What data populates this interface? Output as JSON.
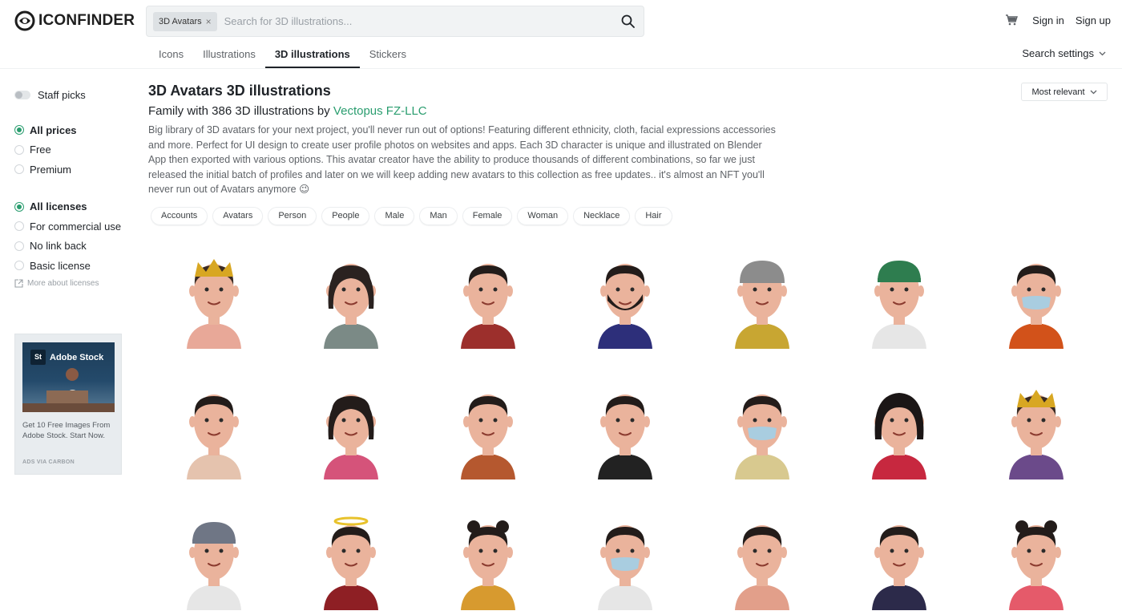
{
  "header": {
    "logo_text": "ICONFINDER",
    "search_chip": "3D Avatars",
    "search_placeholder": "Search for 3D illustrations...",
    "sign_in": "Sign in",
    "sign_up": "Sign up"
  },
  "tabs": [
    {
      "label": "Icons",
      "active": false
    },
    {
      "label": "Illustrations",
      "active": false
    },
    {
      "label": "3D illustrations",
      "active": true
    },
    {
      "label": "Stickers",
      "active": false
    }
  ],
  "search_settings": "Search settings",
  "sidebar": {
    "staff_picks": "Staff picks",
    "prices": [
      "All prices",
      "Free",
      "Premium"
    ],
    "licenses": [
      "All licenses",
      "For commercial use",
      "No link back",
      "Basic license"
    ],
    "more_licenses": "More about licenses"
  },
  "ad": {
    "brand": "Adobe Stock",
    "logo": "St",
    "text": "Get 10 Free Images From Adobe Stock. Start Now.",
    "via": "ADS VIA CARBON"
  },
  "main": {
    "title": "3D Avatars 3D illustrations",
    "subtitle_prefix": "Family with 386 3D illustrations by ",
    "author": "Vectopus FZ-LLC",
    "description": "Big library of 3D avatars for your next project, you'll never run out of options! Featuring different ethnicity, cloth, facial expressions accessories and more. Perfect for UI design to create user profile photos on websites and apps. Each 3D character is unique and illustrated on Blender App then exported with various options. This avatar creator have the ability to produce thousands of different combinations, so far we just released the initial batch of profiles and later on we will keep adding new avatars to this collection as free updates.. it's almost an NFT you'll never run out of Avatars anymore 😉",
    "tags": [
      "Accounts",
      "Avatars",
      "Person",
      "People",
      "Male",
      "Man",
      "Female",
      "Woman",
      "Necklace",
      "Hair"
    ],
    "sort": "Most relevant"
  },
  "avatars": [
    {
      "hair": "#3a2b24",
      "shirt": "#e8a898",
      "extra": "crown-icon"
    },
    {
      "hair": "#2a2220",
      "shirt": "#7b8a86",
      "extra": "long-hair"
    },
    {
      "hair": "#231c1a",
      "shirt": "#9c2f2c",
      "extra": "hoodie"
    },
    {
      "hair": "#231c1a",
      "shirt": "#2d2f7a",
      "extra": "beard"
    },
    {
      "hair": "#8c8c8c",
      "shirt": "#c8a632",
      "extra": "beanie"
    },
    {
      "hair": "#2e7d4f",
      "shirt": "#e6e6e6",
      "extra": "cap"
    },
    {
      "hair": "#231c1a",
      "shirt": "#d2521a",
      "extra": "mask"
    },
    {
      "hair": "#231c1a",
      "shirt": "#e5c3ae",
      "extra": ""
    },
    {
      "hair": "#231c1a",
      "shirt": "#d5537a",
      "extra": "long-hair"
    },
    {
      "hair": "#231c1a",
      "shirt": "#b5582f",
      "extra": "hoodie"
    },
    {
      "hair": "#231c1a",
      "shirt": "#222222",
      "extra": ""
    },
    {
      "hair": "#231c1a",
      "shirt": "#d8c98f",
      "extra": "mask"
    },
    {
      "hair": "#1b1616",
      "shirt": "#c7283f",
      "extra": "curly-hair"
    },
    {
      "hair": "#3a2b24",
      "shirt": "#6b4a8a",
      "extra": "crown-icon"
    },
    {
      "hair": "#6f7685",
      "shirt": "#e6e6e6",
      "extra": "cap"
    },
    {
      "hair": "#231c1a",
      "shirt": "#8e1f24",
      "extra": "halo-icon"
    },
    {
      "hair": "#231c1a",
      "shirt": "#d79a2f",
      "extra": "buns"
    },
    {
      "hair": "#231c1a",
      "shirt": "#e6e6e6",
      "extra": "mask"
    },
    {
      "hair": "#231c1a",
      "shirt": "#e29f8a",
      "extra": ""
    },
    {
      "hair": "#231c1a",
      "shirt": "#2c2a4a",
      "extra": ""
    },
    {
      "hair": "#231c1a",
      "shirt": "#e55a6a",
      "extra": "buns"
    }
  ],
  "colors": {
    "accent": "#2a9d6f",
    "skin": "#eab39c"
  }
}
